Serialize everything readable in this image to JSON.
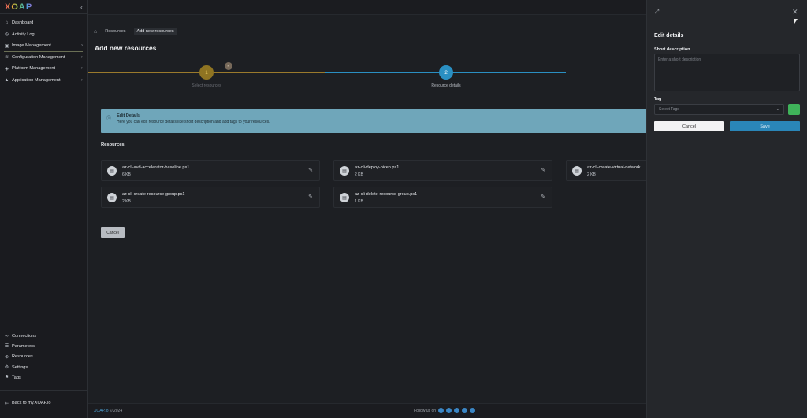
{
  "app": {
    "logo": "XOAP",
    "collapse_icon": "chevron-left-icon"
  },
  "sidebar": {
    "items": [
      {
        "label": "Dashboard",
        "icon": "⌂",
        "chevron": false
      },
      {
        "label": "Activity Log",
        "icon": "◷",
        "chevron": false
      },
      {
        "label": "Image Management",
        "icon": "▣",
        "chevron": true
      },
      {
        "label": "Configuration Management",
        "icon": "≋",
        "chevron": true
      },
      {
        "label": "Platform Management",
        "icon": "◈",
        "chevron": true
      },
      {
        "label": "Application Management",
        "icon": "▲",
        "chevron": true
      }
    ],
    "bottom": [
      {
        "label": "Connections",
        "icon": "∞"
      },
      {
        "label": "Parameters",
        "icon": "☰"
      },
      {
        "label": "Resources",
        "icon": "⊕"
      },
      {
        "label": "Settings",
        "icon": "⚙"
      },
      {
        "label": "Tags",
        "icon": "⚑"
      }
    ],
    "back_label": "Back to my.XOAP.io"
  },
  "breadcrumb": {
    "items": [
      "Resources",
      "Add new resources"
    ]
  },
  "page_title": "Add new resources",
  "stepper": {
    "steps": [
      {
        "number": "1",
        "label": "Select resources"
      },
      {
        "number": "2",
        "label": "Resource details"
      }
    ]
  },
  "info": {
    "title": "Edit Details",
    "description": "Here you can edit resource details like short description and add tags to your resources."
  },
  "resources": {
    "title": "Resources",
    "items": [
      {
        "name": "az-cli-avd-accelerator-baseline.ps1",
        "size": "6 KB"
      },
      {
        "name": "az-cli-deploy-bicep.ps1",
        "size": "2 KB"
      },
      {
        "name": "az-cli-create-virtual-network",
        "size": "2 KB"
      },
      {
        "name": "az-cli-create-resource-group.ps1",
        "size": "2 KB"
      },
      {
        "name": "az-cli-delete-resource-group.ps1",
        "size": "1 KB"
      }
    ]
  },
  "main_cancel": "Cancel",
  "footer": {
    "brand": "XOAP.io",
    "copyright": "© 2024",
    "follow": "Follow us on"
  },
  "drawer": {
    "title": "Edit details",
    "short_desc_label": "Short description",
    "short_desc_placeholder": "Enter a short description",
    "tag_label": "Tag",
    "tag_placeholder": "Select Tags",
    "cancel": "Cancel",
    "save": "Save"
  }
}
